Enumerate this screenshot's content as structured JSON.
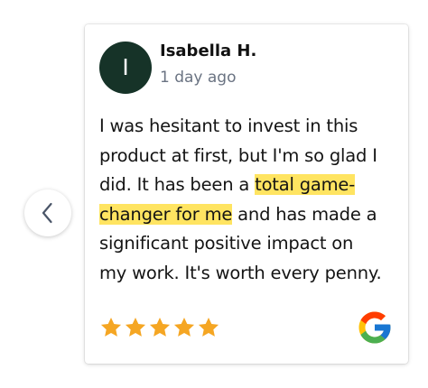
{
  "carousel": {
    "prev_icon": "chevron-left-icon"
  },
  "review": {
    "author": {
      "name": "Isabella H.",
      "initial": "I",
      "avatar_color": "#163328"
    },
    "time_ago": "1 day ago",
    "text_lines": [
      [
        "I was hesitant to invest in this"
      ],
      [
        "product at first, but I'm so glad I"
      ],
      [
        "did. It has been a ",
        "total game-"
      ],
      [
        "changer for me",
        " and has made a"
      ],
      [
        "significant positive impact on"
      ],
      [
        "my work. It's worth every penny."
      ]
    ],
    "highlighted_text": "total game-changer for me",
    "highlight_color": "#ffe461",
    "rating": 5,
    "rating_max": 5,
    "star_color": "#f5a623",
    "source_icon": "google-icon"
  }
}
